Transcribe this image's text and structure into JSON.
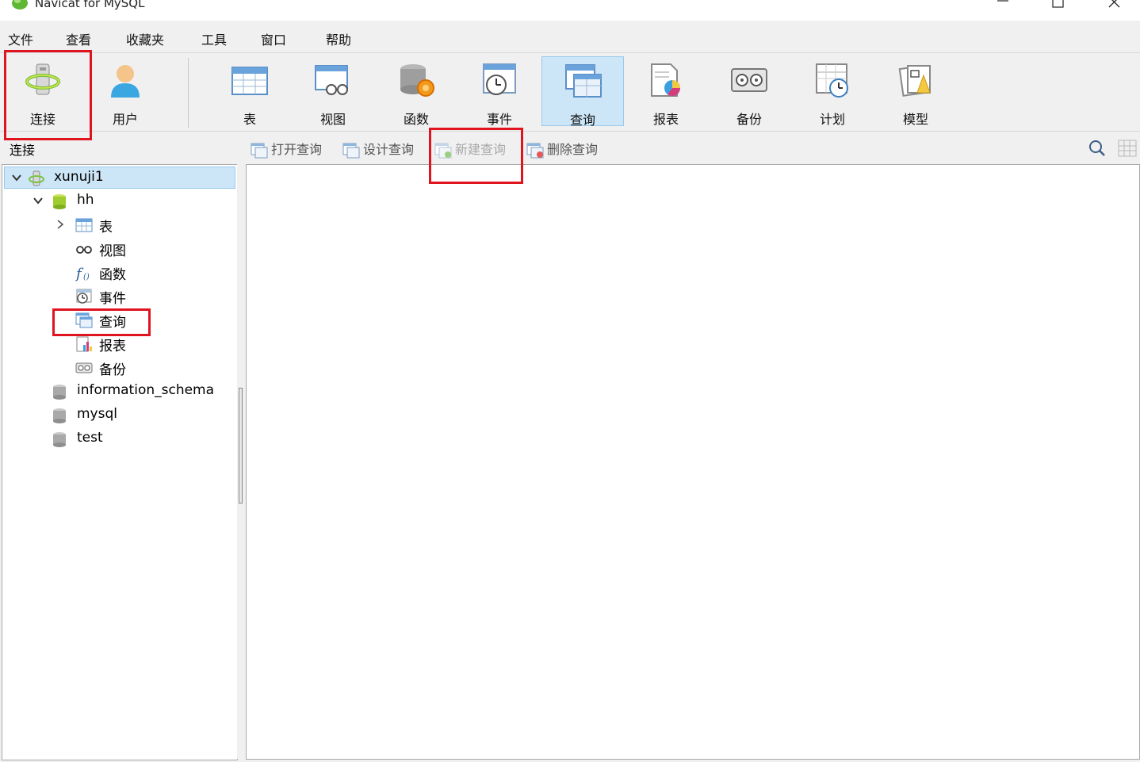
{
  "app": {
    "title": "Navicat for MySQL"
  },
  "menu": [
    "文件",
    "查看",
    "收藏夹",
    "工具",
    "窗口",
    "帮助"
  ],
  "toolbar": {
    "connect_label": "连接",
    "user_label": "用户",
    "objects": [
      "表",
      "视图",
      "函数",
      "事件",
      "查询",
      "报表",
      "备份",
      "计划",
      "模型"
    ],
    "active": "查询"
  },
  "left_header": "连接",
  "query_toolbar": {
    "open": "打开查询",
    "design": "设计查询",
    "new": "新建查询",
    "delete": "删除查询"
  },
  "tree": {
    "connection": "xunuji1",
    "database": "hh",
    "objects": [
      "表",
      "视图",
      "函数",
      "事件",
      "查询",
      "报表",
      "备份"
    ],
    "other_databases": [
      "information_schema",
      "mysql",
      "test"
    ]
  },
  "colors": {
    "highlight": "#e0141e",
    "selection": "#cde6f7"
  }
}
